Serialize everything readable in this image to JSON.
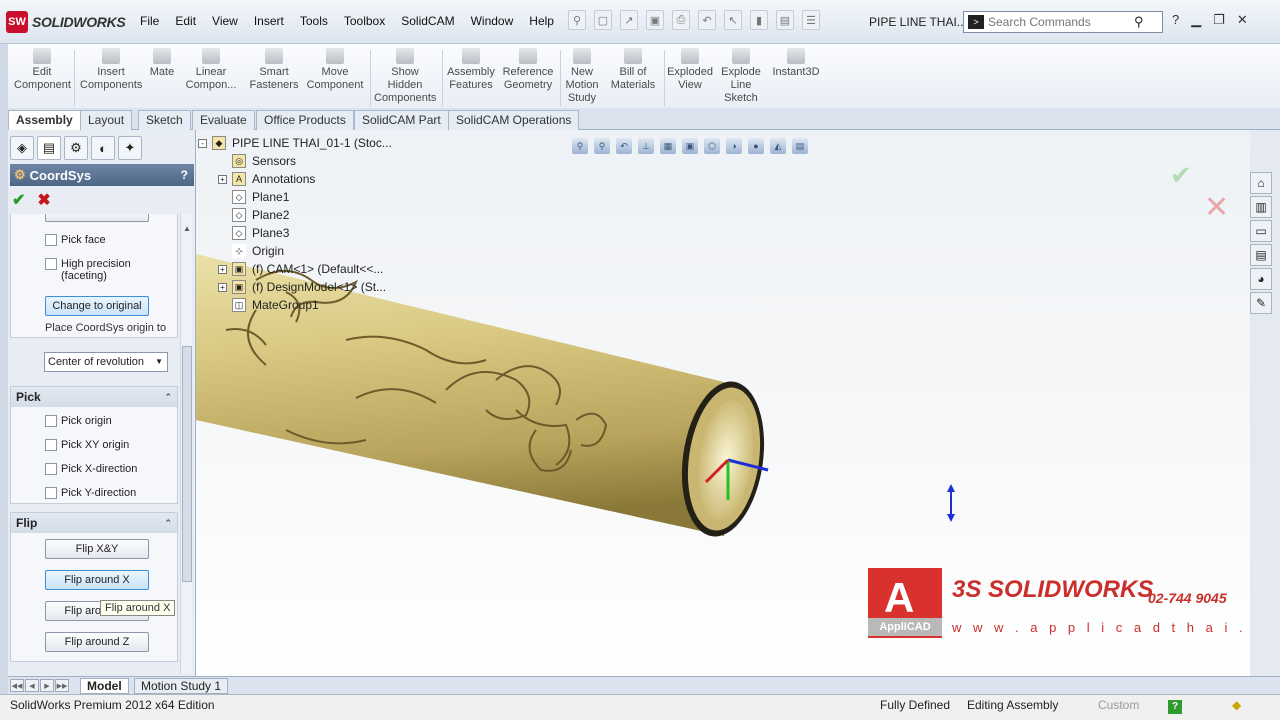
{
  "app": {
    "logo_text": "SOLIDWORKS",
    "logo_badge": "SW"
  },
  "menu": [
    "File",
    "Edit",
    "View",
    "Insert",
    "Tools",
    "Toolbox",
    "SolidCAM",
    "Window",
    "Help"
  ],
  "document_title": "PIPE LINE THAI...",
  "search": {
    "placeholder": "Search Commands"
  },
  "command_manager": [
    {
      "label": "Edit Component",
      "icon": "edit-component-icon"
    },
    {
      "label": "Insert Components",
      "icon": "insert-components-icon"
    },
    {
      "label": "Mate",
      "icon": "mate-icon"
    },
    {
      "label": "Linear Compon...",
      "icon": "linear-pattern-icon"
    },
    {
      "label": "Smart Fasteners",
      "icon": "smart-fasteners-icon"
    },
    {
      "label": "Move Component",
      "icon": "move-component-icon"
    },
    {
      "label": "Show Hidden Components",
      "icon": "show-hidden-icon"
    },
    {
      "label": "Assembly Features",
      "icon": "assembly-features-icon"
    },
    {
      "label": "Reference Geometry",
      "icon": "reference-geometry-icon"
    },
    {
      "label": "New Motion Study",
      "icon": "motion-study-icon"
    },
    {
      "label": "Bill of Materials",
      "icon": "bom-icon"
    },
    {
      "label": "Exploded View",
      "icon": "exploded-view-icon"
    },
    {
      "label": "Explode Line Sketch",
      "icon": "explode-line-icon"
    },
    {
      "label": "Instant3D",
      "icon": "instant3d-icon"
    }
  ],
  "tabs": [
    "Assembly",
    "Layout",
    "Sketch",
    "Evaluate",
    "Office Products",
    "SolidCAM Part",
    "SolidCAM Operations"
  ],
  "active_tab": "Assembly",
  "property_manager": {
    "title": "CoordSys",
    "help": "?",
    "checks": {
      "pick_face": "Pick face",
      "high_precision": "High precision (faceting)"
    },
    "change_to_original": "Change to original",
    "place_origin_label": "Place CoordSys origin to",
    "place_origin_value": "Center of revolution",
    "pick_group": {
      "title": "Pick",
      "items": [
        "Pick origin",
        "Pick XY origin",
        "Pick X-direction",
        "Pick Y-direction"
      ]
    },
    "flip_group": {
      "title": "Flip",
      "buttons": [
        "Flip  X&Y",
        "Flip around X",
        "Flip around Y",
        "Flip around Z"
      ]
    },
    "tooltip": "Flip around X"
  },
  "feature_tree": [
    {
      "label": "PIPE LINE THAI_01-1  (Stoc...",
      "icon": "assembly-icon",
      "expander": "-"
    },
    {
      "label": "Sensors",
      "icon": "sensors-icon",
      "expander": ""
    },
    {
      "label": "Annotations",
      "icon": "annotations-icon",
      "expander": "+"
    },
    {
      "label": "Plane1",
      "icon": "plane-icon",
      "expander": ""
    },
    {
      "label": "Plane2",
      "icon": "plane-icon",
      "expander": ""
    },
    {
      "label": "Plane3",
      "icon": "plane-icon",
      "expander": ""
    },
    {
      "label": "Origin",
      "icon": "origin-icon",
      "expander": ""
    },
    {
      "label": "(f) CAM<1> (Default<<...",
      "icon": "part-icon",
      "expander": "+"
    },
    {
      "label": "(f) DesignModel<1> (St...",
      "icon": "part-icon",
      "expander": "+"
    },
    {
      "label": "MateGroup1",
      "icon": "mates-icon",
      "expander": ""
    }
  ],
  "watermark": {
    "brand": "ApplICAD",
    "sw": "3S SOLIDWORKS",
    "phone": "02-744 9045",
    "url": "w w w . a p p l i c a d t h a i . c o m"
  },
  "bottom_tabs": [
    "Model",
    "Motion Study 1"
  ],
  "active_bottom_tab": "Model",
  "status": {
    "edition": "SolidWorks Premium 2012 x64 Edition",
    "defined": "Fully Defined",
    "editing": "Editing Assembly",
    "custom": "Custom",
    "help_badge": "?"
  },
  "colors": {
    "pipe": "#d8c686",
    "accent": "#c9302c",
    "ok": "#2c9a2c",
    "cancel": "#c4161c"
  }
}
